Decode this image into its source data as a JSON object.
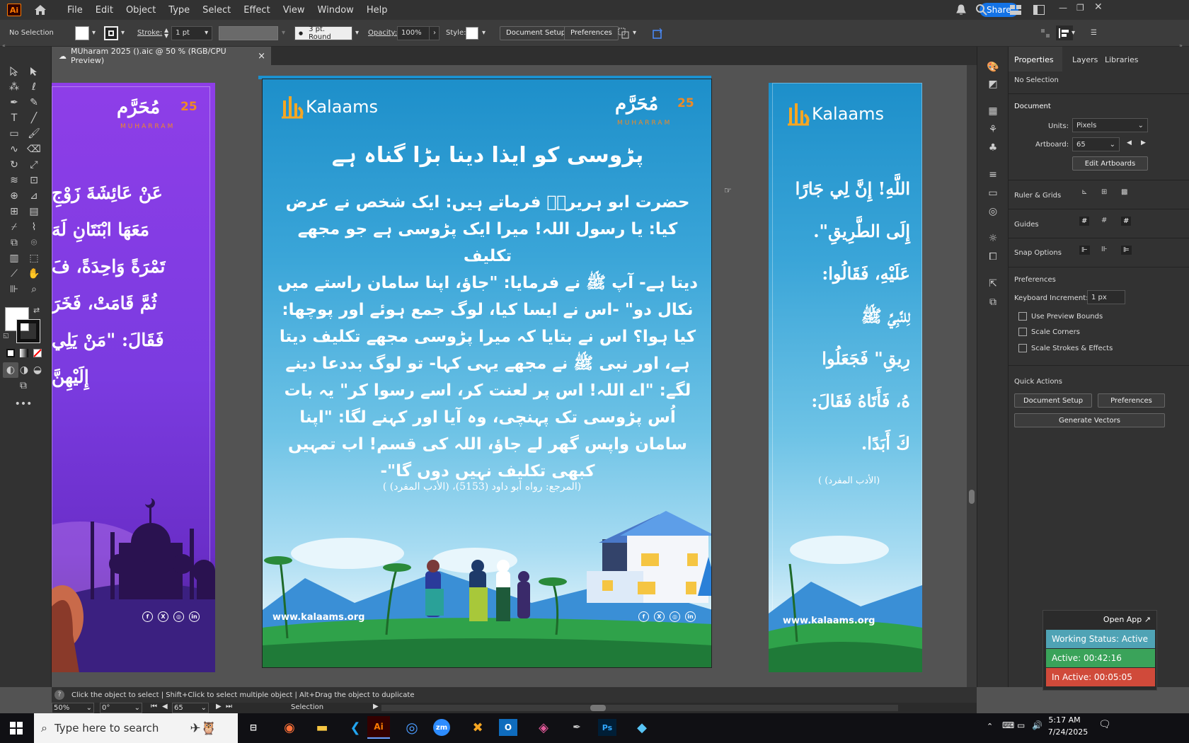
{
  "app": {
    "logo": "Ai",
    "menu": [
      "File",
      "Edit",
      "Object",
      "Type",
      "Select",
      "Effect",
      "View",
      "Window",
      "Help"
    ],
    "share_label": "Share"
  },
  "control_bar": {
    "selection": "No Selection",
    "stroke_label": "Stroke:",
    "stroke_value": "1 pt",
    "brush_value": "3 pt. Round",
    "opacity_label": "Opacity:",
    "opacity_value": "100%",
    "style_label": "Style:",
    "document_setup": "Document Setup",
    "preferences": "Preferences"
  },
  "document": {
    "tab_title": "MUharam 2025 ().aic @ 50 % (RGB/CPU Preview)",
    "close": "×"
  },
  "artboard_center": {
    "brand": "Kalaams",
    "logo_num": "25",
    "logo_muharram_ar": "مُحَرَّم",
    "logo_muharram_en": "MUHARRAM",
    "title": "پڑوسی کو ایذا دینا بڑا گناہ ہے",
    "body_lines": [
      "حضرت ابو ہریرہؓ فرماتے ہیں: ایک شخص نے عرض",
      "کیا: یا رسول اللہ! میرا ایک پڑوسی ہے جو مجھے تکلیف",
      "دیتا ہے- آپ ﷺ نے فرمایا: \"جاؤ، اپنا سامان راستے میں",
      "نکال دو\" -اس نے ایسا کیا، لوگ جمع ہوئے اور پوچھا:",
      "کیا ہوا؟ اس نے بتایا کہ میرا پڑوسی مجھے تکلیف دیتا",
      "ہے، اور نبی ﷺ نے مجھے یہی کہا- تو لوگ بددعا دینے",
      "لگے: \"اے اللہ! اس پر لعنت کر، اسے رسوا کر\" یہ بات",
      "اُس پڑوسی تک پہنچی، وہ آیا اور کہنے لگا: \"اپنا",
      "سامان واپس گھر لے جاؤ، اللہ کی قسم! اب تمہیں",
      "کبھی تکلیف نہیں دوں گا\"-"
    ],
    "reference": "(المرجع: رواه أبو داود (5153)، (الأدب المفرد) )",
    "website": "www.kalaams.org"
  },
  "artboard_left": {
    "logo_num": "25",
    "logo_muharram_ar": "مُحَرَّم",
    "logo_muharram_en": "MUHARRAM",
    "arabic_lines": [
      "عَنْ عَائِشَةَ زَوْجِ",
      "مَعَهَا ابْنَتَانِ لَهَ",
      "تَمْرَةً وَاحِدَةً، فَ",
      "ثُمَّ قَامَتْ، فَخَرَ",
      "فَقَالَ: \"مَنْ يَلِي",
      "إِلَيْهِنَّ"
    ]
  },
  "artboard_right": {
    "brand": "Kalaams",
    "arabic_lines": [
      "اللَّهِ! إِنَّ لِي جَارًا",
      "إِلَى الطَّرِيقِ\".",
      "عَلَيْهِ، فَقَالُوا:",
      "لِلنَّبِيِّ ﷺ",
      "رِيقِ\" فَجَعَلُوا",
      "هُ، فَأَتَاهُ فَقَالَ:",
      "كَ أَبَدًا."
    ],
    "reference": "(الأدب المفرد) )",
    "website": "www.kalaams.org"
  },
  "properties_panel": {
    "tabs": [
      "Properties",
      "Layers",
      "Libraries"
    ],
    "no_selection": "No Selection",
    "document_header": "Document",
    "units_label": "Units:",
    "units_value": "Pixels",
    "artboard_label": "Artboard:",
    "artboard_value": "65",
    "edit_artboards": "Edit Artboards",
    "ruler_grids": "Ruler & Grids",
    "guides": "Guides",
    "snap_options": "Snap Options",
    "preferences_header": "Preferences",
    "keyboard_increment_label": "Keyboard Increment:",
    "keyboard_increment_value": "1 px",
    "checkboxes": [
      "Use Preview Bounds",
      "Scale Corners",
      "Scale Strokes & Effects"
    ],
    "quick_actions": "Quick Actions",
    "document_setup": "Document Setup",
    "preferences": "Preferences",
    "generate_vectors": "Generate Vectors"
  },
  "status_bar": {
    "hint": "Click the object to select  |  Shift+Click to select multiple object  |  Alt+Drag the object to duplicate",
    "zoom": "50%",
    "rotation": "0°",
    "artboard_num": "65",
    "tool": "Selection"
  },
  "timer_widget": {
    "open_app": "Open App ↗",
    "working_status": "Working Status: Active",
    "active": "Active: 00:42:16",
    "inactive": "In Active: 00:05:05",
    "colors": {
      "status": "#4fa3b5",
      "active": "#3aa35a",
      "inactive": "#d04a3a"
    }
  },
  "taskbar": {
    "search_placeholder": "Type here to search",
    "time": "5:17 AM",
    "date": "7/24/2025"
  }
}
